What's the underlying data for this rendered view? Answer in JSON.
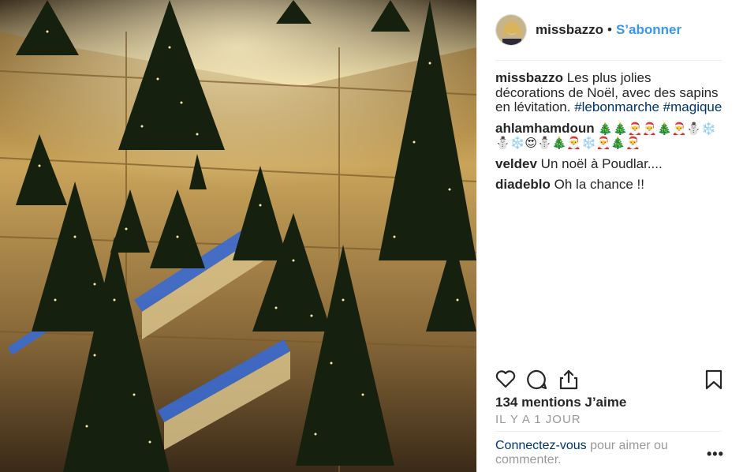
{
  "post": {
    "username": "missbazzo",
    "separator": "•",
    "follow_label": "S’abonner",
    "caption": {
      "text": "Les plus jolies décorations de Noël, avec des sapins en lévitation.",
      "hashtags": [
        "#lebonmarche",
        "#magique"
      ]
    },
    "comments": [
      {
        "user": "ahlamhamdoun",
        "text": "🎄🎄🎅🎅🎄🎅⛄❄️⛄❄️😍⛄🎄🎅❄️🎅🎄🎅"
      },
      {
        "user": "veldev",
        "text": "Un noël à Poudlar...."
      },
      {
        "user": "diadeblo",
        "text": "Oh la chance !!"
      }
    ],
    "likes_label": "134 mentions J’aime",
    "time_label": "IL Y A 1 JOUR",
    "login": {
      "link_label": "Connectez-vous",
      "rest_label": "pour aimer ou commenter."
    },
    "more_label": "•••",
    "icons": [
      "heart-icon",
      "comment-icon",
      "share-icon",
      "bookmark-icon",
      "more-options-icon"
    ],
    "colors": {
      "link": "#3897f0",
      "hashtag": "#003569",
      "muted": "#999999",
      "text": "#262626"
    }
  }
}
